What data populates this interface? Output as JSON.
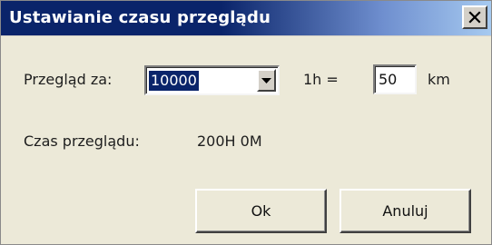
{
  "dialog": {
    "title": "Ustawianie czasu przeglądu",
    "close_label": "×"
  },
  "form": {
    "przeglad_label": "Przegląd za:",
    "przeglad_value": "10000",
    "hour_label": "1h =",
    "km_value": "50",
    "km_unit": "km",
    "czas_label": "Czas przeglądu:",
    "czas_value": "200H  0M"
  },
  "buttons": {
    "ok": "Ok",
    "cancel": "Anuluj"
  },
  "colors": {
    "title_bar": "#0a246a",
    "selection": "#0a246a",
    "dialog_bg": "#ece9d8"
  },
  "icons": {
    "close": "close-icon",
    "dropdown": "chevron-down-icon"
  }
}
